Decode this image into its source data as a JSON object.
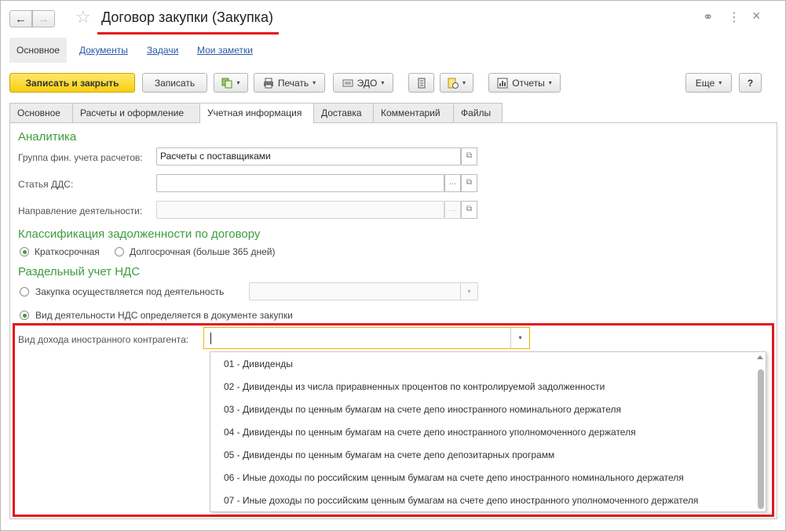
{
  "window": {
    "title": "Договор закупки (Закупка)",
    "back_icon": "←",
    "forward_icon": "→",
    "star_icon": "☆",
    "link_icon": "⚭",
    "more_icon": "⋮",
    "close_icon": "×"
  },
  "sections": [
    {
      "label": "Основное"
    },
    {
      "label": "Документы"
    },
    {
      "label": "Задачи"
    },
    {
      "label": "Мои заметки"
    }
  ],
  "toolbar": {
    "save_close": "Записать и закрыть",
    "save": "Записать",
    "print": "Печать",
    "edo": "ЭДО",
    "reports": "Отчеты",
    "more": "Еще",
    "help": "?"
  },
  "tabs": [
    {
      "label": "Основное"
    },
    {
      "label": "Расчеты и оформление"
    },
    {
      "label": "Учетная информация"
    },
    {
      "label": "Доставка"
    },
    {
      "label": "Комментарий"
    },
    {
      "label": "Файлы"
    }
  ],
  "analytics": {
    "heading": "Аналитика",
    "fin_group_label": "Группа фин. учета расчетов:",
    "fin_group_value": "Расчеты с поставщиками",
    "dds_label": "Статья ДДС:",
    "dds_value": "",
    "direction_label": "Направление деятельности:",
    "direction_value": ""
  },
  "debt": {
    "heading": "Классификация задолженности по договору",
    "short": "Краткосрочная",
    "long": "Долгосрочная (больше 365 дней)",
    "selected": "short"
  },
  "vat": {
    "heading": "Раздельный учет НДС",
    "opt1": "Закупка осуществляется под деятельность",
    "opt2": "Вид деятельности НДС определяется в документе закупки",
    "selected": "opt2"
  },
  "foreign_income": {
    "label": "Вид дохода иностранного контрагента:",
    "value": "",
    "options": [
      "01 - Дивиденды",
      "02 - Дивиденды из числа приравненных процентов по контролируемой задолженности",
      "03 - Дивиденды по ценным бумагам на счете депо иностранного номинального держателя",
      "04 - Дивиденды по ценным бумагам на счете депо иностранного уполномоченного держателя",
      "05 - Дивиденды по ценным бумагам на счете депо депозитарных программ",
      "06 - Иные доходы по российским ценным бумагам на счете депо иностранного номинального держателя",
      "07 - Иные доходы по российским ценным бумагам на счете депо иностранного уполномоченного держателя"
    ]
  },
  "colors": {
    "accent_green": "#3e9c3e",
    "highlight_red": "#e3161b",
    "primary_button": "#f6cf0f",
    "link_blue": "#2a5aa6"
  }
}
